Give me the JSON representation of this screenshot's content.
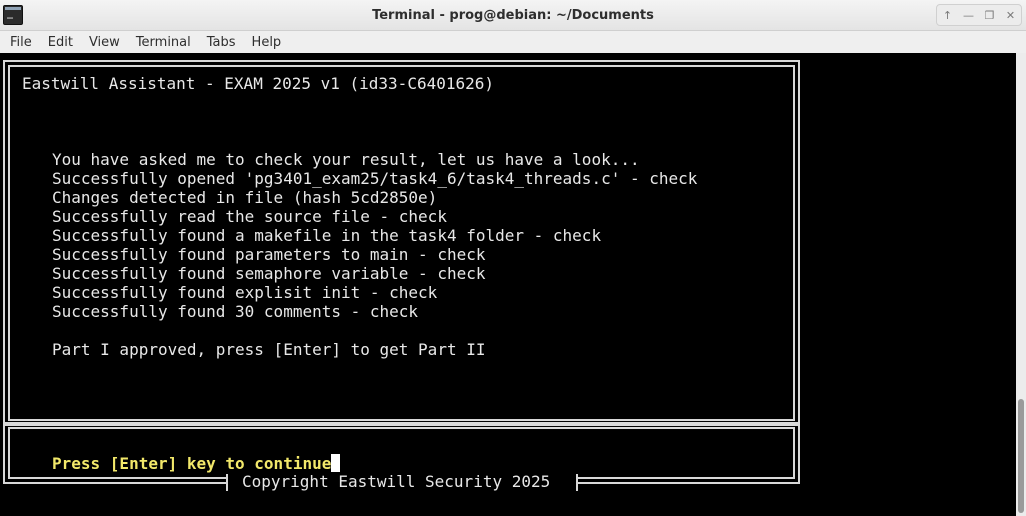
{
  "window": {
    "title": "Terminal - prog@debian: ~/Documents",
    "controls": [
      "arrow-up-icon",
      "minimize-icon",
      "restore-icon",
      "close-icon"
    ]
  },
  "menu": {
    "file": "File",
    "edit": "Edit",
    "view": "View",
    "terminal": "Terminal",
    "tabs": "Tabs",
    "help": "Help"
  },
  "screen": {
    "header": "Eastwill Assistant - EXAM 2025 v1 (id33-C6401626)",
    "lines": [
      "You have asked me to check your result, let us have a look...",
      "Successfully opened 'pg3401_exam25/task4_6/task4_threads.c' - check",
      "Changes detected in file (hash 5cd2850e)",
      "Successfully read the source file - check",
      "Successfully found a makefile in the task4 folder - check",
      "Successfully found parameters to main - check",
      "Successfully found semaphore variable - check",
      "Successfully found explisit init - check",
      "Successfully found 30 comments - check"
    ],
    "status": "Part I approved, press [Enter] to get Part II",
    "prompt": "Press [Enter] key to continue",
    "copyright": "Copyright Eastwill Security 2025"
  },
  "colors": {
    "background": "#000000",
    "foreground": "#e8e8e8",
    "prompt": "#f2e86a",
    "frame": "#d8d8d8"
  }
}
